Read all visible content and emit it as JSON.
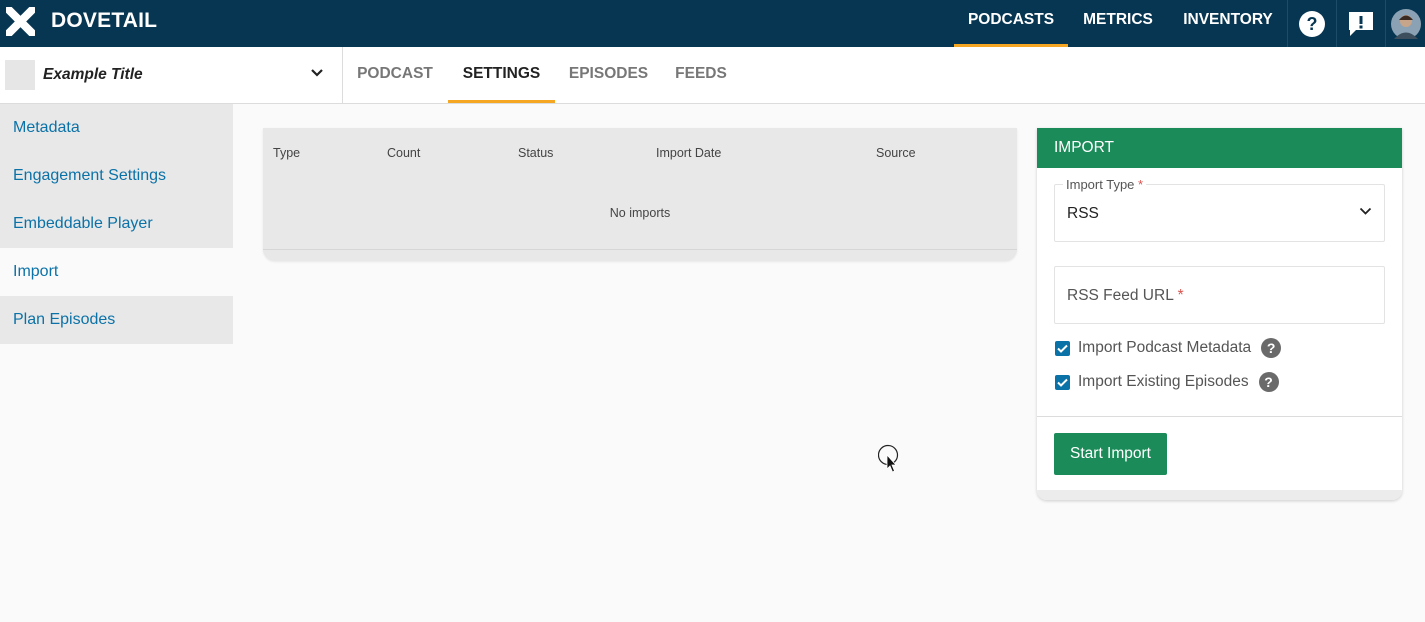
{
  "brand": {
    "name": "DOVETAIL"
  },
  "top_nav": [
    {
      "label": "PODCASTS",
      "active": true
    },
    {
      "label": "METRICS",
      "active": false
    },
    {
      "label": "INVENTORY",
      "active": false
    }
  ],
  "top_icons": {
    "help": "help-icon",
    "feedback": "feedback-icon",
    "avatar": "user-avatar"
  },
  "podcast_selector": {
    "title": "Example Title"
  },
  "tabs": [
    {
      "label": "PODCAST",
      "active": false
    },
    {
      "label": "SETTINGS",
      "active": true
    },
    {
      "label": "EPISODES",
      "active": false
    },
    {
      "label": "FEEDS",
      "active": false
    }
  ],
  "sidebar": {
    "items": [
      {
        "label": "Metadata",
        "active": false
      },
      {
        "label": "Engagement Settings",
        "active": false
      },
      {
        "label": "Embeddable Player",
        "active": false
      },
      {
        "label": "Import",
        "active": true
      },
      {
        "label": "Plan Episodes",
        "active": false
      }
    ]
  },
  "imports_table": {
    "columns": [
      "Type",
      "Count",
      "Status",
      "Import Date",
      "Source"
    ],
    "empty_message": "No imports"
  },
  "import_panel": {
    "title": "IMPORT",
    "import_type": {
      "label": "Import Type",
      "required_mark": "*",
      "value": "RSS"
    },
    "feed_url": {
      "label": "RSS Feed URL",
      "required_mark": "*",
      "value": ""
    },
    "checkboxes": [
      {
        "label": "Import Podcast Metadata",
        "checked": true
      },
      {
        "label": "Import Existing Episodes",
        "checked": true
      }
    ],
    "help_glyph": "?",
    "submit_label": "Start Import"
  },
  "colors": {
    "header_bg": "#073652",
    "accent_orange": "#f5a623",
    "green": "#1b8c59",
    "link_blue": "#0b72a8"
  }
}
